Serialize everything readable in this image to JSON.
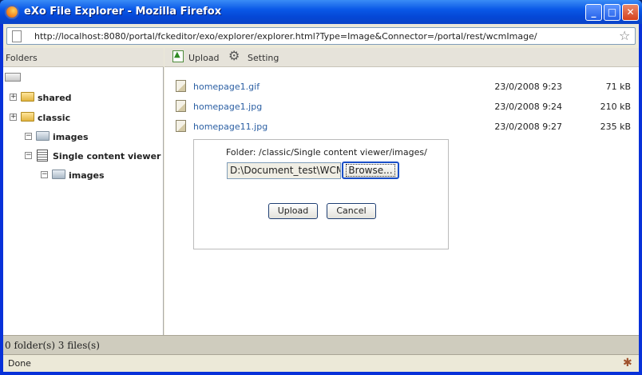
{
  "window": {
    "title": "eXo File Explorer - Mozilla Firefox",
    "controls": {
      "minimize": "_",
      "maximize": "□",
      "close": "✕"
    }
  },
  "address_bar": {
    "url": "http://localhost:8080/portal/fckeditor/exo/explorer/explorer.html?Type=Image&Connector=/portal/rest/wcmImage/"
  },
  "sidebar": {
    "header": "Folders",
    "tree": [
      {
        "label": "shared",
        "expander": "+",
        "icon": "folder-open-icon"
      },
      {
        "label": "classic",
        "expander": "+",
        "icon": "folder-open-icon"
      },
      {
        "label": "images",
        "expander": "−",
        "icon": "folder-icon"
      },
      {
        "label": "Single content viewer",
        "expander": "−",
        "icon": "document-icon"
      },
      {
        "label": "images",
        "expander": "−",
        "icon": "folder-icon"
      }
    ]
  },
  "toolbar": {
    "upload_label": "Upload",
    "setting_label": "Setting"
  },
  "files": [
    {
      "name": "homepage1.gif",
      "date": "23/0/2008 9:23",
      "size": "71 kB"
    },
    {
      "name": "homepage1.jpg",
      "date": "23/0/2008 9:24",
      "size": "210 kB"
    },
    {
      "name": "homepage11.jpg",
      "date": "23/0/2008 9:27",
      "size": "235 kB"
    }
  ],
  "status": {
    "summary": "0 folder(s) 3 files(s)",
    "browser_status": "Done"
  },
  "upload_dialog": {
    "folder_path": "Folder: /classic/Single content viewer/images/",
    "file_value": "D:\\Document_test\\WCM",
    "browse_label": "Browse...",
    "upload_label": "Upload",
    "cancel_label": "Cancel"
  }
}
